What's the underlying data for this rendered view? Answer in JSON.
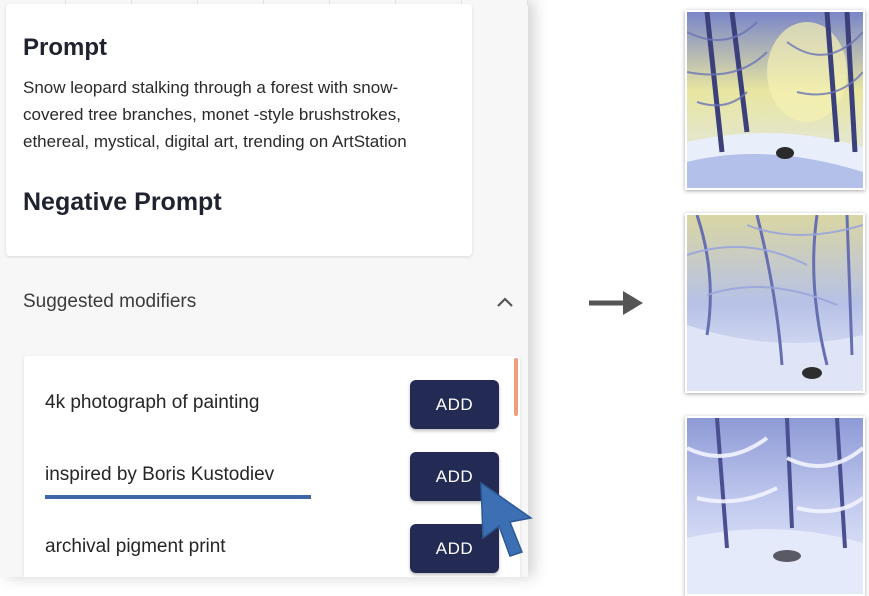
{
  "prompt": {
    "heading": "Prompt",
    "text": "Snow leopard stalking through a forest with snow-covered tree branches, monet -style brushstrokes, ethereal, mystical, digital art, trending on ArtStation",
    "negative_heading": "Negative Prompt"
  },
  "suggestions": {
    "title": "Suggested modifiers",
    "toggle_icon": "chevron-up-icon",
    "items": [
      {
        "label": "4k photograph of painting",
        "button": "ADD"
      },
      {
        "label": "inspired by Boris Kustodiev",
        "button": "ADD"
      },
      {
        "label": "archival pigment print",
        "button": "ADD"
      }
    ]
  },
  "colors": {
    "button_bg": "#232b55",
    "underline": "#3f67a8",
    "cursor": "#3c6fb4",
    "scroll_thumb": "#e9a07b"
  },
  "icons": {
    "arrow": "arrow-right-icon",
    "cursor": "mouse-pointer-icon"
  }
}
